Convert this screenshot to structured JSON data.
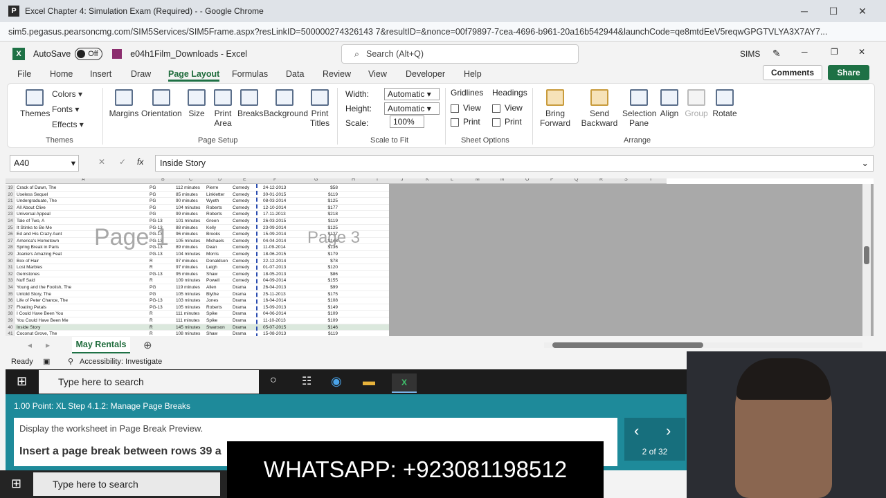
{
  "browser": {
    "title": "Excel Chapter 4: Simulation Exam (Required) - - Google Chrome",
    "url": "sim5.pegasus.pearsoncmg.com/SIM5Services/SIM5Frame.aspx?resLinkID=500000274326143 7&resultID=&nonce=00f79897-7cea-4696-b961-20a16b542944&launchCode=qe8mtdEeV5reqwGPGTVLYA3X7AY7...",
    "minimize": "─",
    "maximize": "☐",
    "close": "✕"
  },
  "excel": {
    "autosave": "AutoSave",
    "autosave_state": "Off",
    "filename": "e04h1Film_Downloads - Excel",
    "search": "Search (Alt+Q)",
    "user": "SIMS",
    "comments": "Comments",
    "share": "Share"
  },
  "tabs": [
    "File",
    "Home",
    "Insert",
    "Draw",
    "Page Layout",
    "Formulas",
    "Data",
    "Review",
    "View",
    "Developer",
    "Help"
  ],
  "ribbon": {
    "themes": {
      "themes": "Themes",
      "colors": "Colors",
      "fonts": "Fonts",
      "effects": "Effects",
      "group": "Themes"
    },
    "page_setup": {
      "margins": "Margins",
      "orientation": "Orientation",
      "size": "Size",
      "print_area": "Print Area",
      "breaks": "Breaks",
      "background": "Background",
      "print_titles": "Print Titles",
      "group": "Page Setup"
    },
    "scale": {
      "width_label": "Width:",
      "width_value": "Automatic",
      "height_label": "Height:",
      "height_value": "Automatic",
      "scale_label": "Scale:",
      "scale_value": "100%",
      "group": "Scale to Fit"
    },
    "sheet_options": {
      "gridlines": "Gridlines",
      "headings": "Headings",
      "view": "View",
      "print": "Print",
      "group": "Sheet Options"
    },
    "arrange": {
      "bring_forward": "Bring Forward",
      "send_backward": "Send Backward",
      "selection_pane": "Selection Pane",
      "align": "Align",
      "group_btn": "Group",
      "rotate": "Rotate",
      "group": "Arrange"
    }
  },
  "formula_bar": {
    "name_box": "A40",
    "fx": "fx",
    "value": "Inside Story"
  },
  "columns": [
    "A",
    "B",
    "C",
    "D",
    "E",
    "F",
    "G",
    "H",
    "I",
    "J",
    "K",
    "L",
    "M",
    "N",
    "O",
    "P",
    "Q",
    "R",
    "S",
    "T"
  ],
  "watermarks": {
    "page1": "Page 1",
    "page3": "Page 3"
  },
  "rows": [
    {
      "n": "19",
      "a": "Crack of Dawn, The",
      "b": "PG",
      "c": "112 minutes",
      "d": "Pierre",
      "e": "Comedy",
      "f": "24-12-2013",
      "g": "$58"
    },
    {
      "n": "20",
      "a": "Useless Sequel",
      "b": "PG",
      "c": "85 minutes",
      "d": "Linkletter",
      "e": "Comedy",
      "f": "30-01-2015",
      "g": "$119"
    },
    {
      "n": "21",
      "a": "Undergraduate, The",
      "b": "PG",
      "c": "90 minutes",
      "d": "Wyeth",
      "e": "Comedy",
      "f": "08-03-2014",
      "g": "$125"
    },
    {
      "n": "22",
      "a": "All About Clive",
      "b": "PG",
      "c": "104 minutes",
      "d": "Roberts",
      "e": "Comedy",
      "f": "12-10-2014",
      "g": "$177"
    },
    {
      "n": "23",
      "a": "Universal Appeal",
      "b": "PG",
      "c": "99 minutes",
      "d": "Roberts",
      "e": "Comedy",
      "f": "17-11-2013",
      "g": "$218"
    },
    {
      "n": "24",
      "a": "Tale of Two, A",
      "b": "PG-13",
      "c": "101 minutes",
      "d": "Green",
      "e": "Comedy",
      "f": "26-03-2015",
      "g": "$119"
    },
    {
      "n": "25",
      "a": "It Stinks to Be Me",
      "b": "PG-13",
      "c": "88 minutes",
      "d": "Kelly",
      "e": "Comedy",
      "f": "23-09-2014",
      "g": "$125"
    },
    {
      "n": "26",
      "a": "Ed and His Crazy Aunt",
      "b": "PG-13",
      "c": "96 minutes",
      "d": "Brooks",
      "e": "Comedy",
      "f": "15-09-2014",
      "g": "$127"
    },
    {
      "n": "27",
      "a": "America's Hometown",
      "b": "PG-13",
      "c": "105 minutes",
      "d": "Michaels",
      "e": "Comedy",
      "f": "04-04-2014",
      "g": "$148"
    },
    {
      "n": "28",
      "a": "Spring Break in Paris",
      "b": "PG-13",
      "c": "89 minutes",
      "d": "Dean",
      "e": "Comedy",
      "f": "11-09-2014",
      "g": "$136"
    },
    {
      "n": "29",
      "a": "Joanie's Amazing Feat",
      "b": "PG-13",
      "c": "104 minutes",
      "d": "Morris",
      "e": "Comedy",
      "f": "18-06-2015",
      "g": "$179"
    },
    {
      "n": "30",
      "a": "Box of Hair",
      "b": "R",
      "c": "97 minutes",
      "d": "Donaldson",
      "e": "Comedy",
      "f": "22-12-2014",
      "g": "$78"
    },
    {
      "n": "31",
      "a": "Lost Marbles",
      "b": "R",
      "c": "97 minutes",
      "d": "Leigh",
      "e": "Comedy",
      "f": "01-07-2013",
      "g": "$120"
    },
    {
      "n": "32",
      "a": "Gemstones",
      "b": "PG-13",
      "c": "95 minutes",
      "d": "Shaw",
      "e": "Comedy",
      "f": "18-05-2013",
      "g": "$86"
    },
    {
      "n": "33",
      "a": "Nuff Said",
      "b": "R",
      "c": "109 minutes",
      "d": "Powell",
      "e": "Comedy",
      "f": "04-09-2014",
      "g": "$155"
    },
    {
      "n": "34",
      "a": "Young and the Foolish, The",
      "b": "PG",
      "c": "119 minutes",
      "d": "Allen",
      "e": "Drama",
      "f": "26-04-2013",
      "g": "$99"
    },
    {
      "n": "35",
      "a": "Untold Story, The",
      "b": "PG",
      "c": "105 minutes",
      "d": "Blythe",
      "e": "Drama",
      "f": "25-11-2013",
      "g": "$175"
    },
    {
      "n": "36",
      "a": "Life of Peter Chance, The",
      "b": "PG-13",
      "c": "103 minutes",
      "d": "Jones",
      "e": "Drama",
      "f": "16-04-2014",
      "g": "$108"
    },
    {
      "n": "37",
      "a": "Floating Petals",
      "b": "PG-13",
      "c": "105 minutes",
      "d": "Roberts",
      "e": "Drama",
      "f": "15-09-2013",
      "g": "$149"
    },
    {
      "n": "38",
      "a": "I Could Have Been You",
      "b": "R",
      "c": "111 minutes",
      "d": "Spike",
      "e": "Drama",
      "f": "04-06-2014",
      "g": "$109"
    },
    {
      "n": "39",
      "a": "You Could Have Been Me",
      "b": "R",
      "c": "111 minutes",
      "d": "Spike",
      "e": "Drama",
      "f": "11-10-2013",
      "g": "$109"
    },
    {
      "n": "40",
      "a": "Inside Story",
      "b": "R",
      "c": "145 minutes",
      "d": "Swanson",
      "e": "Drama",
      "f": "05-07-2015",
      "g": "$146"
    },
    {
      "n": "41",
      "a": "Coconut Grove, The",
      "b": "R",
      "c": "108 minutes",
      "d": "Shaw",
      "e": "Drama",
      "f": "15-08-2013",
      "g": "$119"
    }
  ],
  "sheet_tab": "May Rentals",
  "status": {
    "ready": "Ready",
    "accessibility": "Accessibility: Investigate"
  },
  "taskbar": {
    "search": "Type here to search"
  },
  "sim": {
    "header": "1.00 Point: XL Step 4.1.2: Manage Page Breaks",
    "line1": "Display the worksheet in Page Break Preview.",
    "line2": "Insert a page break between rows 39 a",
    "counter": "2 of 32"
  },
  "overlay": {
    "whatsapp": "WHATSAPP: +923081198512"
  }
}
